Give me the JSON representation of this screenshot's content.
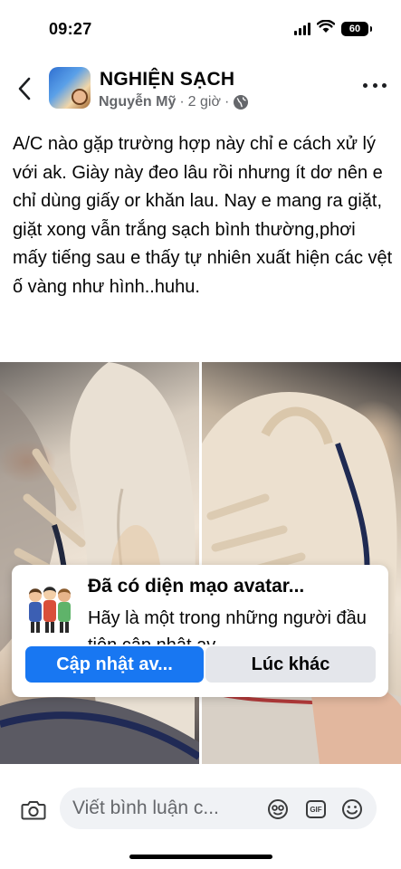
{
  "status_bar": {
    "time": "09:27",
    "battery": "60"
  },
  "header": {
    "group_name": "NGHIỆN SẠCH",
    "author": "Nguyễn Mỹ",
    "separator": "·",
    "time_ago": "2 giờ",
    "separator2": "·"
  },
  "post": {
    "text": "A/C nào gặp trường hợp này chỉ e cách xử lý với ak. Giày này đeo lâu rồi nhưng ít dơ nên e chỉ dùng giấy or khăn lau. Nay e mang ra giặt, giặt xong vẫn trắng sạch bình thường,phơi mấy tiếng sau e thấy tự nhiên xuất hiện các vệt ố vàng như hình..huhu."
  },
  "avatar_prompt": {
    "title": "Đã có diện mạo avatar...",
    "body": "Hãy là một trong những người đầu tiên cập nhật av",
    "primary_button": "Cập nhật av...",
    "secondary_button": "Lúc khác"
  },
  "comment_bar": {
    "placeholder": "Viết bình luận c...",
    "gif_label": "GIF"
  },
  "colors": {
    "accent": "#1877f2",
    "secondary_button_bg": "#e4e6eb",
    "meta_text": "#65676b",
    "input_bg": "#f0f2f5"
  },
  "icons": [
    "signal-icon",
    "wifi-icon",
    "battery-icon",
    "back-icon",
    "globe-icon",
    "more-icon",
    "camera-icon",
    "sticker-icon",
    "gif-icon",
    "emoji-icon"
  ]
}
